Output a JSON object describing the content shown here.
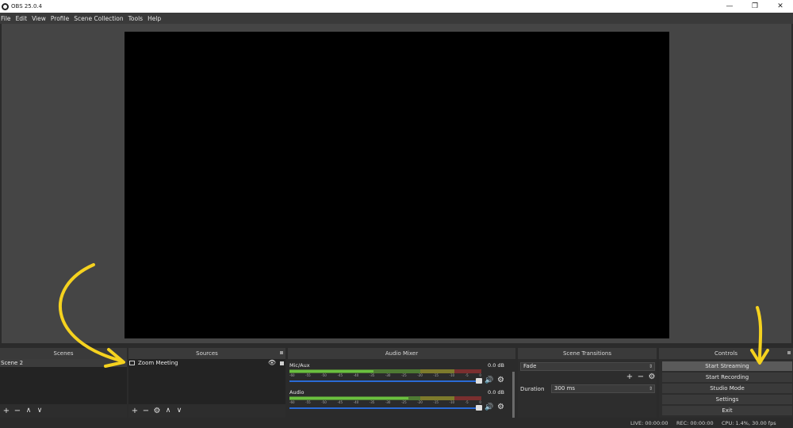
{
  "window": {
    "title": "OBS 25.0.4",
    "minimize": "—",
    "maximize": "❐",
    "close": "✕"
  },
  "menu": [
    "File",
    "Edit",
    "View",
    "Profile",
    "Scene Collection",
    "Tools",
    "Help"
  ],
  "docks": {
    "scenes": {
      "title": "Scenes",
      "items": [
        "Scene 2"
      ]
    },
    "sources": {
      "title": "Sources",
      "items": [
        {
          "label": "Zoom Meeting",
          "visible": true,
          "locked": true
        }
      ]
    },
    "audio_mixer": {
      "title": "Audio Mixer",
      "ticks": [
        "-60",
        "-55",
        "-50",
        "-45",
        "-40",
        "-35",
        "-30",
        "-25",
        "-20",
        "-15",
        "-10",
        "-5",
        "0"
      ],
      "channels": [
        {
          "name": "Mic/Aux",
          "db": "0.0 dB",
          "level": 0.44
        },
        {
          "name": "Audio",
          "db": "0.0 dB",
          "level": 0.62
        }
      ]
    },
    "scene_transitions": {
      "title": "Scene Transitions",
      "transition": "Fade",
      "duration_label": "Duration",
      "duration_value": "300 ms"
    },
    "controls": {
      "title": "Controls",
      "buttons": [
        "Start Streaming",
        "Start Recording",
        "Studio Mode",
        "Settings",
        "Exit"
      ]
    }
  },
  "status": {
    "live": "LIVE: 00:00:00",
    "rec": "REC: 00:00:00",
    "cpu": "CPU: 1.4%, 30.00 fps"
  },
  "colors": {
    "accent": "#2a6bd6",
    "annotation": "#f5d21f"
  }
}
